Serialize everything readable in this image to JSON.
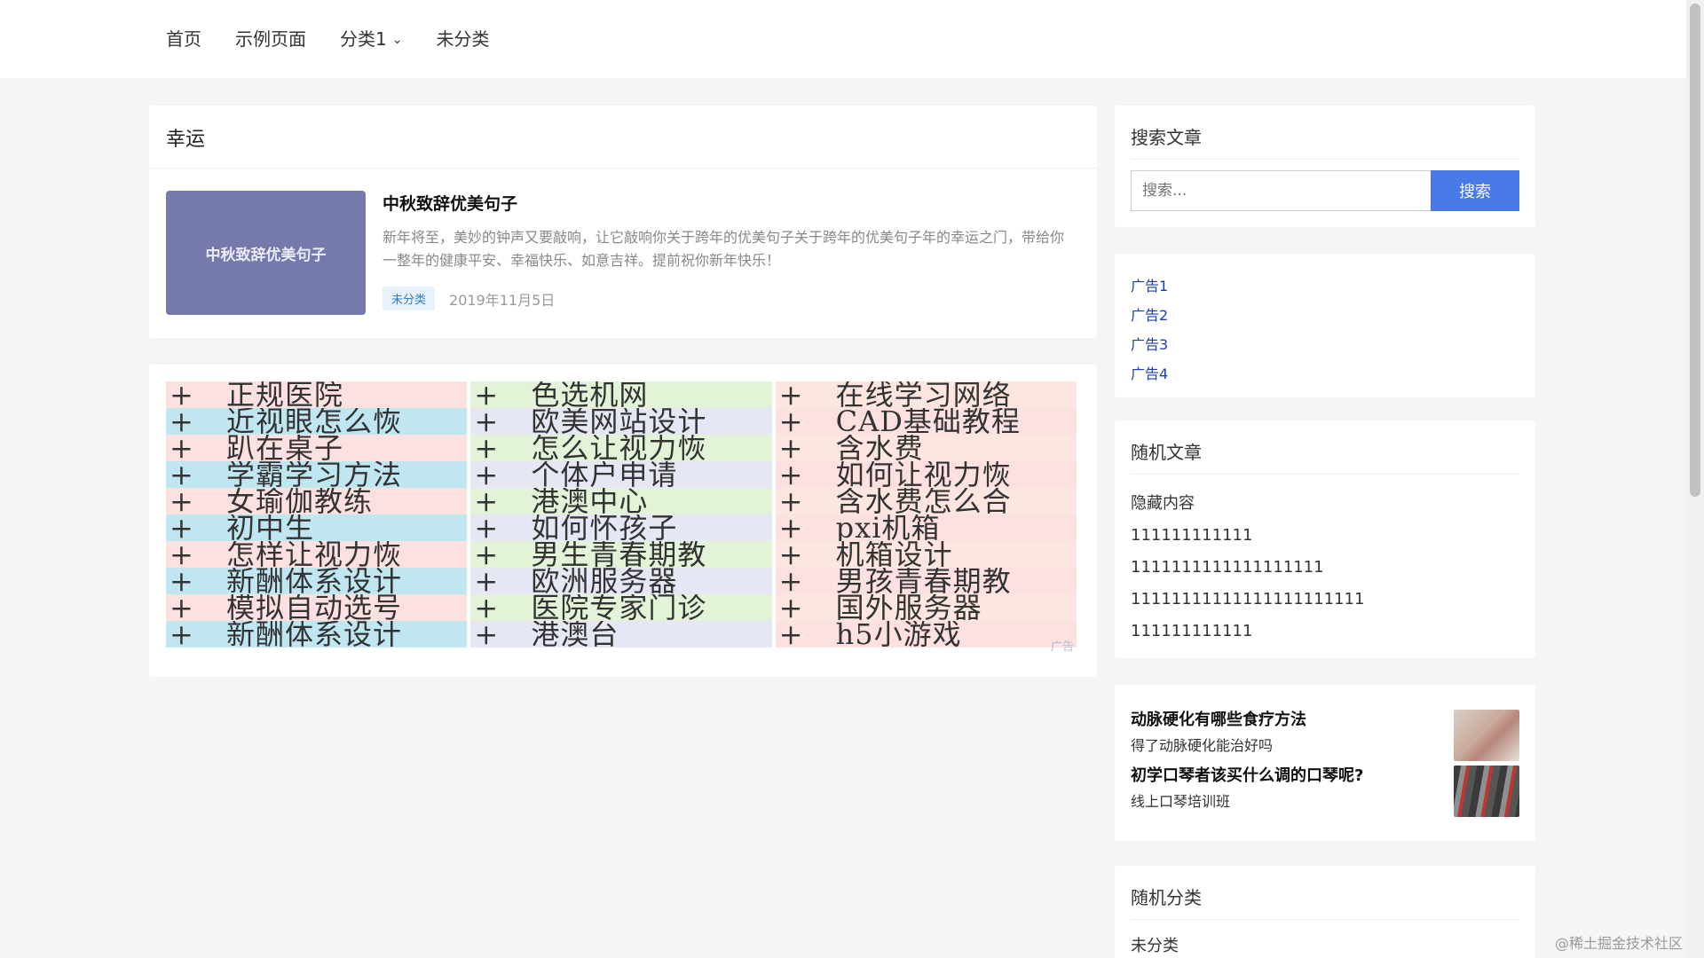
{
  "nav": {
    "items": [
      "首页",
      "示例页面",
      "分类1",
      "未分类"
    ]
  },
  "main": {
    "section_title": "幸运",
    "post": {
      "thumb_text": "中秋致辞优美句子",
      "title": "中秋致辞优美句子",
      "excerpt": "新年将至，美妙的钟声又要敲响，让它敲响你关于跨年的优美句子关于跨年的优美句子年的幸运之门，带给你一整年的健康平安、幸福快乐、如意吉祥。提前祝你新年快乐！",
      "tag": "未分类",
      "date": "2019年11月5日"
    }
  },
  "ad_block": {
    "mark": "广告",
    "columns": [
      [
        {
          "plus": "+",
          "text": "正规医院"
        },
        {
          "plus": "+",
          "text": "近视眼怎么恢"
        },
        {
          "plus": "+",
          "text": "趴在桌子"
        },
        {
          "plus": "+",
          "text": "学霸学习方法"
        },
        {
          "plus": "+",
          "text": "女瑜伽教练"
        },
        {
          "plus": "+",
          "text": "初中生"
        },
        {
          "plus": "+",
          "text": "怎样让视力恢"
        },
        {
          "plus": "+",
          "text": "新酬体系设计"
        },
        {
          "plus": "+",
          "text": "模拟自动选号"
        },
        {
          "plus": "+",
          "text": "新酬体系设计"
        }
      ],
      [
        {
          "plus": "+",
          "text": "色选机网"
        },
        {
          "plus": "+",
          "text": "欧美网站设计"
        },
        {
          "plus": "+",
          "text": "怎么让视力恢"
        },
        {
          "plus": "+",
          "text": "个体户申请"
        },
        {
          "plus": "+",
          "text": "港澳中心"
        },
        {
          "plus": "+",
          "text": "如何怀孩子"
        },
        {
          "plus": "+",
          "text": "男生青春期教"
        },
        {
          "plus": "+",
          "text": "欧洲服务器"
        },
        {
          "plus": "+",
          "text": "医院专家门诊"
        },
        {
          "plus": "+",
          "text": "港澳台"
        }
      ],
      [
        {
          "plus": "+",
          "text": "在线学习网络"
        },
        {
          "plus": "+",
          "text": "CAD基础教程"
        },
        {
          "plus": "+",
          "text": "含水费"
        },
        {
          "plus": "+",
          "text": "如何让视力恢"
        },
        {
          "plus": "+",
          "text": "含水费怎么合"
        },
        {
          "plus": "+",
          "text": "pxi机箱"
        },
        {
          "plus": "+",
          "text": "机箱设计"
        },
        {
          "plus": "+",
          "text": "男孩青春期教"
        },
        {
          "plus": "+",
          "text": "国外服务器"
        },
        {
          "plus": "+",
          "text": "h5小游戏"
        }
      ]
    ]
  },
  "sidebar": {
    "search": {
      "title": "搜索文章",
      "placeholder": "搜索...",
      "button": "搜索"
    },
    "ads": [
      "广告1",
      "广告2",
      "广告3",
      "广告4"
    ],
    "random_posts": {
      "title": "随机文章",
      "items": [
        "隐藏内容",
        "111111111111",
        "1111111111111111111",
        "11111111111111111111111",
        "111111111111"
      ]
    },
    "promos": [
      {
        "title": "动脉硬化有哪些食疗方法",
        "sub": "得了动脉硬化能治好吗"
      },
      {
        "title": "初学口琴者该买什么调的口琴呢?",
        "sub": "线上口琴培训班"
      }
    ],
    "random_categories": {
      "title": "随机分类",
      "items": [
        "未分类"
      ]
    }
  },
  "watermark": "@稀土掘金技术社区"
}
